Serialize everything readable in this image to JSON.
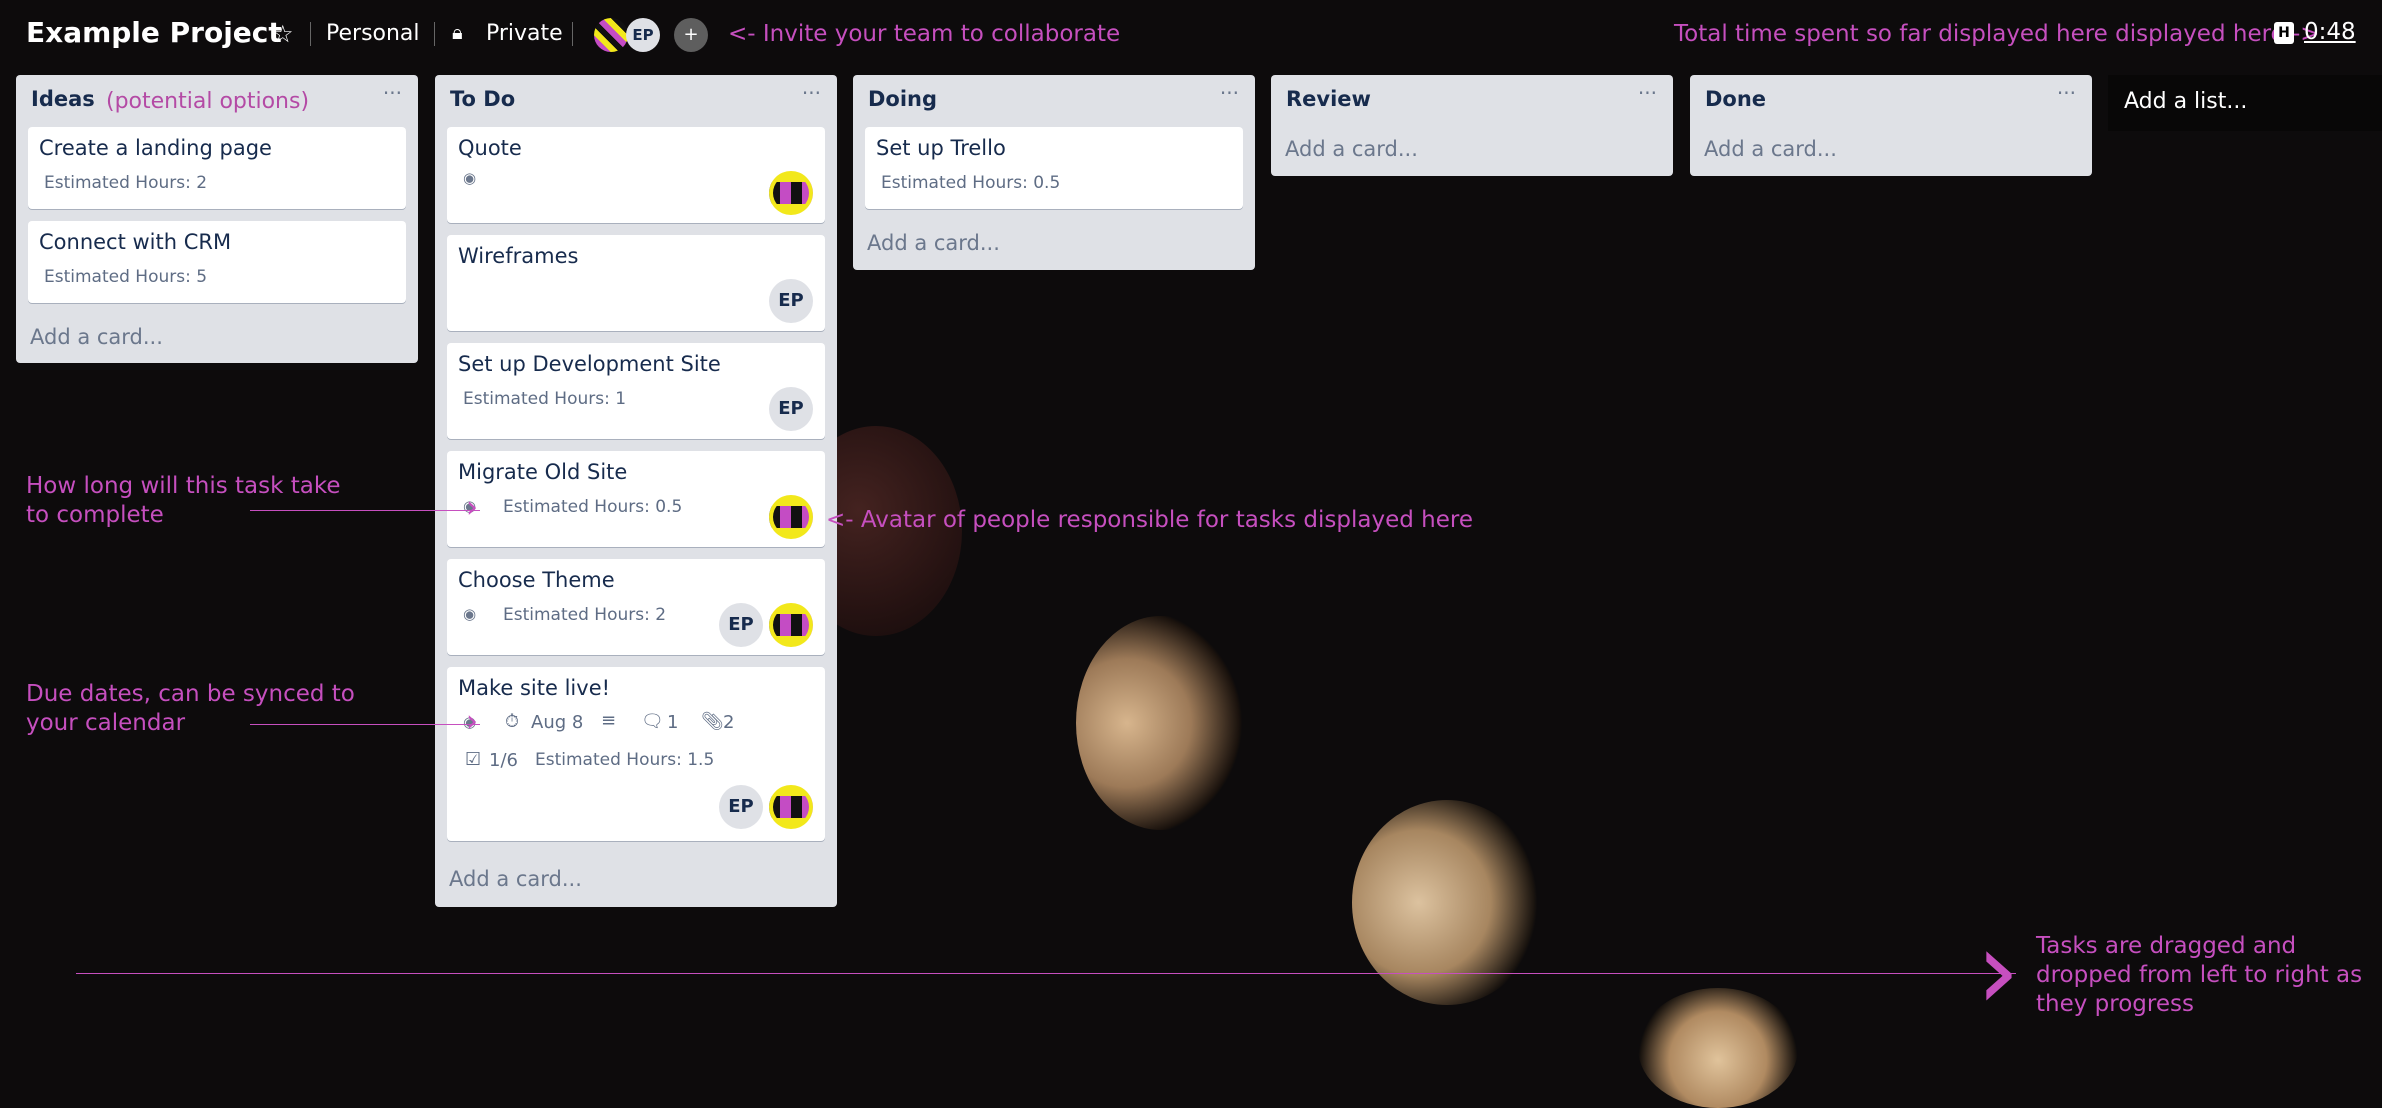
{
  "header": {
    "board_title": "Example Project",
    "team_label": "Personal",
    "visibility_label": "Private",
    "avatar_initials": "EP",
    "invite_annotation": "<- Invite your team to collaborate",
    "time_annotation": "Total time spent so far displayed here displayed here ->",
    "timer_icon_letter": "H",
    "timer_value": "0:48"
  },
  "lists": {
    "ideas": {
      "title": "Ideas",
      "subtitle": "(potential options)",
      "cards": [
        {
          "title": "Create a landing page",
          "meta": "Estimated Hours: 2"
        },
        {
          "title": "Connect with CRM",
          "meta": "Estimated Hours: 5"
        }
      ],
      "add_card": "Add a card..."
    },
    "todo": {
      "title": "To Do",
      "cards": [
        {
          "title": "Quote"
        },
        {
          "title": "Wireframes",
          "avatar": "EP"
        },
        {
          "title": "Set up Development Site",
          "meta": "Estimated Hours: 1",
          "avatar": "EP"
        },
        {
          "title": "Migrate Old Site",
          "meta": "Estimated Hours: 0.5"
        },
        {
          "title": "Choose Theme",
          "meta": "Estimated Hours: 2",
          "avatar": "EP"
        },
        {
          "title": "Make site live!",
          "due": "Aug 8",
          "comments": "1",
          "attachments": "2",
          "checklist": "1/6",
          "meta": "Estimated Hours: 1.5",
          "avatar": "EP"
        }
      ],
      "add_card": "Add a card..."
    },
    "doing": {
      "title": "Doing",
      "cards": [
        {
          "title": "Set up Trello",
          "meta": "Estimated Hours: 0.5"
        }
      ],
      "add_card": "Add a card..."
    },
    "review": {
      "title": "Review",
      "add_card": "Add a card..."
    },
    "done": {
      "title": "Done",
      "add_card": "Add a card..."
    }
  },
  "add_list": "Add a list...",
  "annotations": {
    "estimate": "How long will this task take to complete",
    "avatar": "<- Avatar of people responsible for tasks displayed here",
    "due": "Due dates, can be synced to your calendar",
    "flow": "Tasks are dragged and dropped from left to right as they progress"
  },
  "colors": {
    "annotation": "#c64fbf",
    "list_bg": "#dfe1e6",
    "card_bg": "#ffffff"
  }
}
